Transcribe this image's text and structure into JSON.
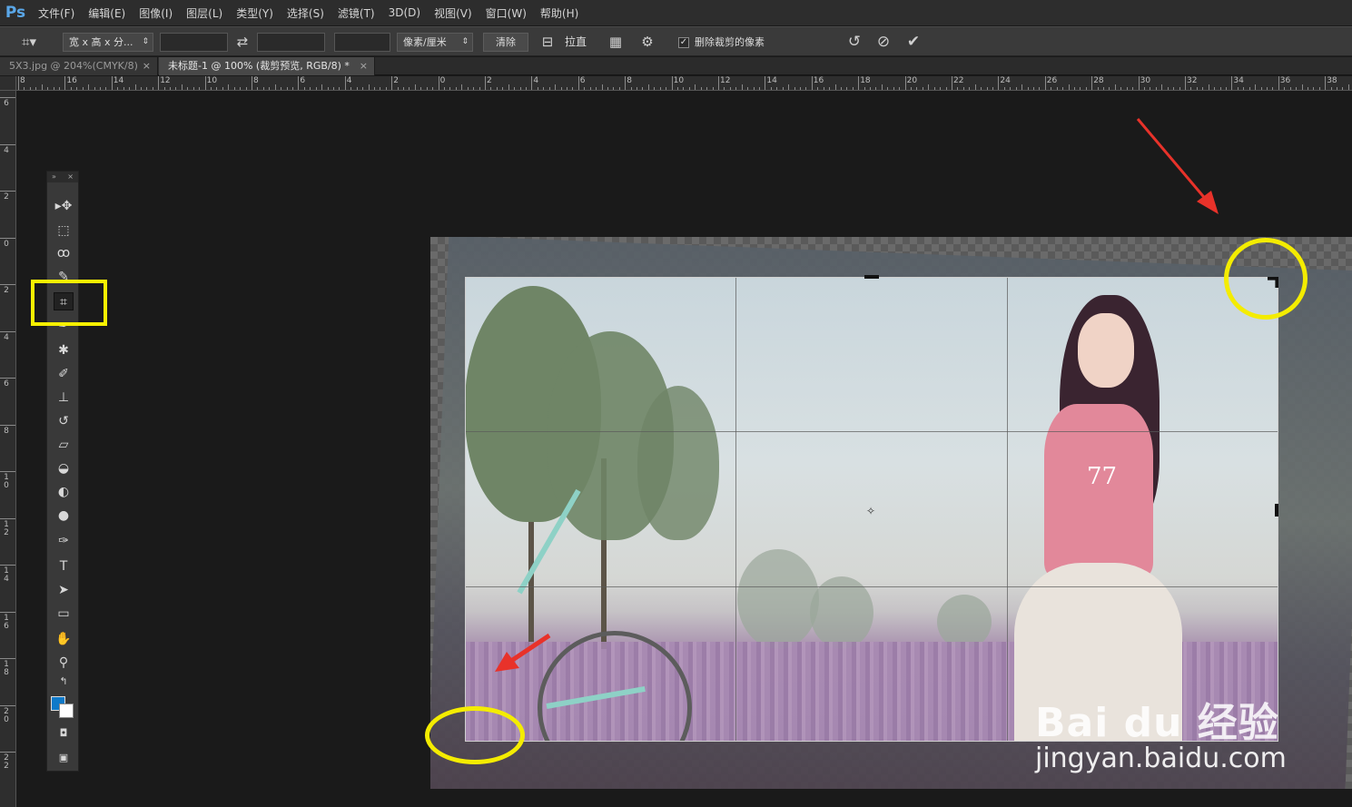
{
  "app": {
    "logo": "Ps"
  },
  "menu": [
    "文件(F)",
    "编辑(E)",
    "图像(I)",
    "图层(L)",
    "类型(Y)",
    "选择(S)",
    "滤镜(T)",
    "3D(D)",
    "视图(V)",
    "窗口(W)",
    "帮助(H)"
  ],
  "options": {
    "ratio_select": "宽 x 高 x 分...",
    "width_value": "",
    "height_value": "",
    "resolution_value": "",
    "unit_select": "像素/厘米",
    "clear_label": "清除",
    "straighten_label": "拉直",
    "delete_pixels_label": "删除裁剪的像素",
    "delete_pixels_checked": true
  },
  "tabs": [
    {
      "label": "5X3.jpg @ 204%(CMYK/8)",
      "active": false,
      "close": "×"
    },
    {
      "label": "未标题-1 @ 100% (裁剪预览, RGB/8) *",
      "active": true,
      "close": "×"
    }
  ],
  "ruler": {
    "horizontal": [
      "8",
      "16",
      "14",
      "12",
      "10",
      "8",
      "6",
      "4",
      "2",
      "0",
      "2",
      "4",
      "6",
      "8",
      "10",
      "12",
      "14",
      "16",
      "18",
      "20",
      "22",
      "24",
      "26",
      "28",
      "30",
      "32",
      "34",
      "36",
      "38"
    ],
    "vertical": [
      "6",
      "4",
      "2",
      "0",
      "2",
      "4",
      "6",
      "8",
      "10",
      "12",
      "14",
      "16",
      "18",
      "20",
      "22"
    ]
  },
  "toolbox": {
    "tools": [
      "move-tool",
      "marquee-tool",
      "lasso-tool",
      "quick-select-tool",
      "crop-tool",
      "eyedropper-tool",
      "healing-tool",
      "brush-tool",
      "stamp-tool",
      "history-brush-tool",
      "eraser-tool",
      "paint-bucket-tool",
      "blur-tool",
      "dodge-tool",
      "pen-tool",
      "type-tool",
      "path-select-tool",
      "rectangle-tool",
      "hand-tool",
      "zoom-tool"
    ],
    "active_tool": "crop-tool",
    "foreground_color": "#0f7ac9",
    "background_color": "#ffffff"
  },
  "photo": {
    "shirt_text": "77"
  },
  "watermark": {
    "logo": "Bai du 经验",
    "url": "jingyan.baidu.com"
  },
  "annotation_colors": {
    "highlight": "#f4ec00",
    "arrow": "#e8322a"
  }
}
